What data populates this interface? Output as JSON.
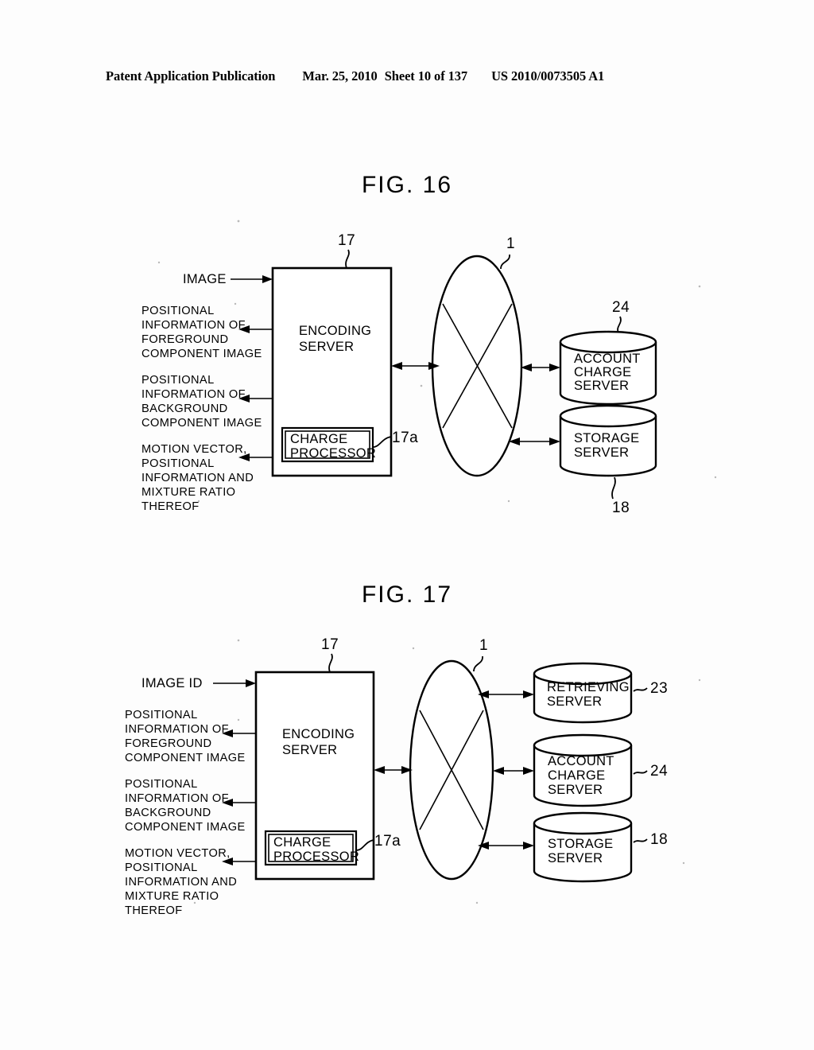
{
  "header": {
    "publication": "Patent Application Publication",
    "date": "Mar. 25, 2010",
    "sheet": "Sheet 10 of 137",
    "patent_number": "US 2010/0073505 A1"
  },
  "figures": [
    {
      "id": "fig16",
      "title": "FIG.  16",
      "inputs": [
        {
          "name": "image-input",
          "text": "IMAGE",
          "direction": "in"
        }
      ],
      "outputs": [
        {
          "name": "foreground-positional-output",
          "lines": [
            "POSITIONAL",
            "INFORMATION  OF",
            "FOREGROUND",
            "COMPONENT  IMAGE"
          ]
        },
        {
          "name": "background-positional-output",
          "lines": [
            "POSITIONAL",
            "INFORMATION  OF",
            "BACKGROUND",
            "COMPONENT  IMAGE"
          ]
        },
        {
          "name": "motion-vector-output",
          "lines": [
            "MOTION  VECTOR,",
            "POSITIONAL",
            "INFORMATION  AND",
            "MIXTURE  RATIO",
            "THEREOF"
          ]
        }
      ],
      "encoding_server": {
        "label_lines": [
          "ENCODING",
          "SERVER"
        ],
        "ref": "17",
        "sub_block": {
          "label_lines": [
            "CHARGE",
            "PROCESSOR"
          ],
          "ref": "17a"
        }
      },
      "network": {
        "ref": "1"
      },
      "servers": [
        {
          "name": "account-charge-server",
          "label_lines": [
            "ACCOUNT",
            "CHARGE",
            "SERVER"
          ],
          "ref": "24",
          "ref_position": "top"
        },
        {
          "name": "storage-server",
          "label_lines": [
            "STORAGE",
            "SERVER"
          ],
          "ref": "18",
          "ref_position": "bottom"
        }
      ]
    },
    {
      "id": "fig17",
      "title": "FIG.  17",
      "inputs": [
        {
          "name": "image-id-input",
          "text": "IMAGE  ID",
          "direction": "in"
        }
      ],
      "outputs": [
        {
          "name": "foreground-positional-output",
          "lines": [
            "POSITIONAL",
            "INFORMATION  OF",
            "FOREGROUND",
            "COMPONENT  IMAGE"
          ]
        },
        {
          "name": "background-positional-output",
          "lines": [
            "POSITIONAL",
            "INFORMATION  OF",
            "BACKGROUND",
            "COMPONENT  IMAGE"
          ]
        },
        {
          "name": "motion-vector-output",
          "lines": [
            "MOTION  VECTOR,",
            "POSITIONAL",
            "INFORMATION  AND",
            "MIXTURE  RATIO",
            "THEREOF"
          ]
        }
      ],
      "encoding_server": {
        "label_lines": [
          "ENCODING",
          "SERVER"
        ],
        "ref": "17",
        "sub_block": {
          "label_lines": [
            "CHARGE",
            "PROCESSOR"
          ],
          "ref": "17a"
        }
      },
      "network": {
        "ref": "1"
      },
      "servers": [
        {
          "name": "retrieving-server",
          "label_lines": [
            "RETRIEVING",
            "SERVER"
          ],
          "ref": "23",
          "ref_position": "right"
        },
        {
          "name": "account-charge-server",
          "label_lines": [
            "ACCOUNT",
            "CHARGE",
            "SERVER"
          ],
          "ref": "24",
          "ref_position": "right"
        },
        {
          "name": "storage-server",
          "label_lines": [
            "STORAGE",
            "SERVER"
          ],
          "ref": "18",
          "ref_position": "right"
        }
      ]
    }
  ]
}
